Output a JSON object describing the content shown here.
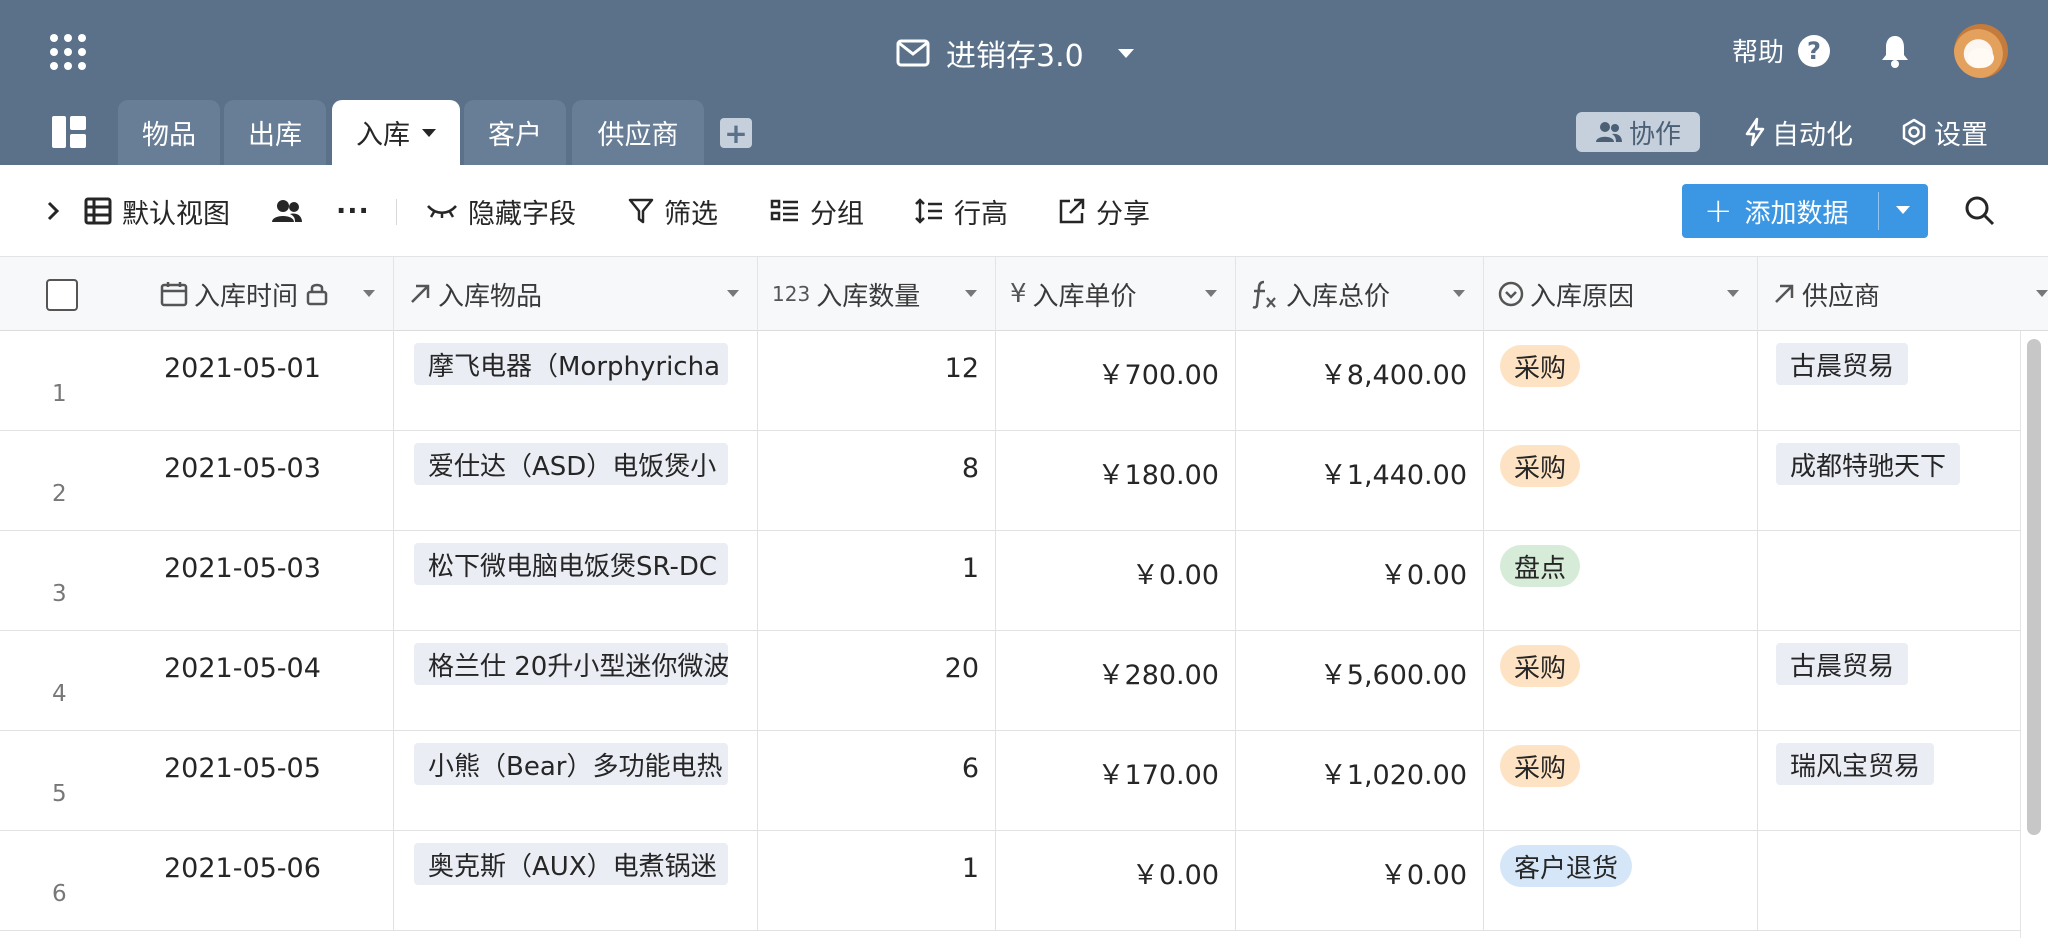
{
  "app": {
    "title": "进销存3.0",
    "help_label": "帮助",
    "help_symbol": "?"
  },
  "tabs": [
    {
      "label": "物品",
      "active": false
    },
    {
      "label": "出库",
      "active": false
    },
    {
      "label": "入库",
      "active": true
    },
    {
      "label": "客户",
      "active": false
    },
    {
      "label": "供应商",
      "active": false
    }
  ],
  "add_tab_symbol": "+",
  "header_actions": {
    "collab": "协作",
    "automation": "自动化",
    "settings": "设置"
  },
  "toolbar": {
    "view": "默认视图",
    "more": "···",
    "hide_fields": "隐藏字段",
    "filter": "筛选",
    "group": "分组",
    "row_height": "行高",
    "share": "分享",
    "add_data": "添加数据",
    "add_symbol": "+"
  },
  "columns": [
    {
      "label": "入库时间",
      "icon": "calendar-icon"
    },
    {
      "label": "入库物品",
      "icon": "link-arrow-icon"
    },
    {
      "label": "入库数量",
      "icon": "number-icon",
      "icon_text": "123"
    },
    {
      "label": "入库单价",
      "icon": "currency-icon",
      "icon_text": "¥"
    },
    {
      "label": "入库总价",
      "icon": "formula-icon"
    },
    {
      "label": "入库原因",
      "icon": "single-select-icon"
    },
    {
      "label": "供应商",
      "icon": "link-arrow-icon"
    }
  ],
  "rows": [
    {
      "n": "1",
      "date": "2021-05-01",
      "item": "摩飞电器（Morphyricha",
      "qty": "12",
      "price": "￥700.00",
      "total": "￥8,400.00",
      "reason": "采购",
      "supplier": "古晨贸易"
    },
    {
      "n": "2",
      "date": "2021-05-03",
      "item": "爱仕达（ASD）电饭煲小",
      "qty": "8",
      "price": "￥180.00",
      "total": "￥1,440.00",
      "reason": "采购",
      "supplier": "成都特驰天下"
    },
    {
      "n": "3",
      "date": "2021-05-03",
      "item": "松下微电脑电饭煲SR-DC",
      "qty": "1",
      "price": "￥0.00",
      "total": "￥0.00",
      "reason": "盘点",
      "supplier": ""
    },
    {
      "n": "4",
      "date": "2021-05-04",
      "item": "格兰仕 20升小型迷你微波",
      "qty": "20",
      "price": "￥280.00",
      "total": "￥5,600.00",
      "reason": "采购",
      "supplier": "古晨贸易"
    },
    {
      "n": "5",
      "date": "2021-05-05",
      "item": "小熊（Bear）多功能电热",
      "qty": "6",
      "price": "￥170.00",
      "total": "￥1,020.00",
      "reason": "采购",
      "supplier": "瑞风宝贸易"
    },
    {
      "n": "6",
      "date": "2021-05-06",
      "item": "奥克斯（AUX）电煮锅迷",
      "qty": "1",
      "price": "￥0.00",
      "total": "￥0.00",
      "reason": "客户退货",
      "supplier": ""
    }
  ],
  "reason_colors": {
    "采购": {
      "bg": "#fde3c3",
      "fg": "#262626"
    },
    "盘点": {
      "bg": "#d6ecd8",
      "fg": "#262626"
    },
    "客户退货": {
      "bg": "#d4e6f7",
      "fg": "#262626"
    }
  },
  "colors": {
    "header_bg": "#5a7189",
    "accent": "#3b97e3"
  }
}
